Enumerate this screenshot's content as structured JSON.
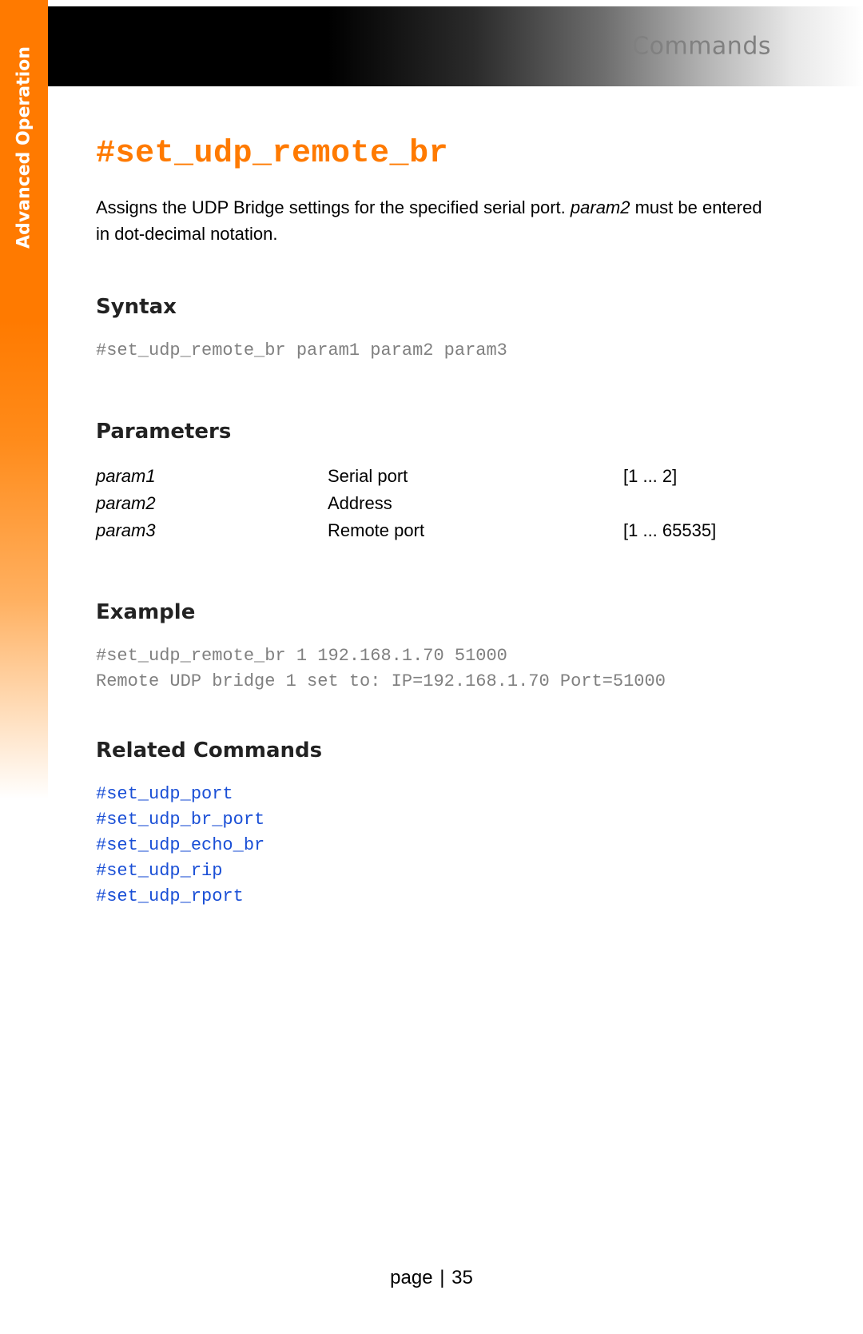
{
  "header": {
    "section": "Commands"
  },
  "sidebar": {
    "label": "Advanced Operation"
  },
  "command": {
    "name": "#set_udp_remote_br",
    "description_before": "Assigns the UDP Bridge settings for the specified serial port.  ",
    "description_param": "param2",
    "description_after": " must be entered in dot-decimal notation."
  },
  "syntax": {
    "heading": "Syntax",
    "code": "#set_udp_remote_br param1 param2 param3"
  },
  "parameters": {
    "heading": "Parameters",
    "rows": [
      {
        "name": "param1",
        "desc": "Serial port",
        "range": "[1 ... 2]"
      },
      {
        "name": "param2",
        "desc": "Address",
        "range": ""
      },
      {
        "name": "param3",
        "desc": "Remote port",
        "range": "[1 ... 65535]"
      }
    ]
  },
  "example": {
    "heading": "Example",
    "code": "#set_udp_remote_br 1 192.168.1.70 51000\nRemote UDP bridge 1 set to: IP=192.168.1.70 Port=51000"
  },
  "related": {
    "heading": "Related Commands",
    "links": [
      "#set_udp_port",
      "#set_udp_br_port",
      "#set_udp_echo_br",
      "#set_udp_rip",
      "#set_udp_rport"
    ]
  },
  "footer": {
    "label": "page",
    "sep": "|",
    "number": "35"
  }
}
